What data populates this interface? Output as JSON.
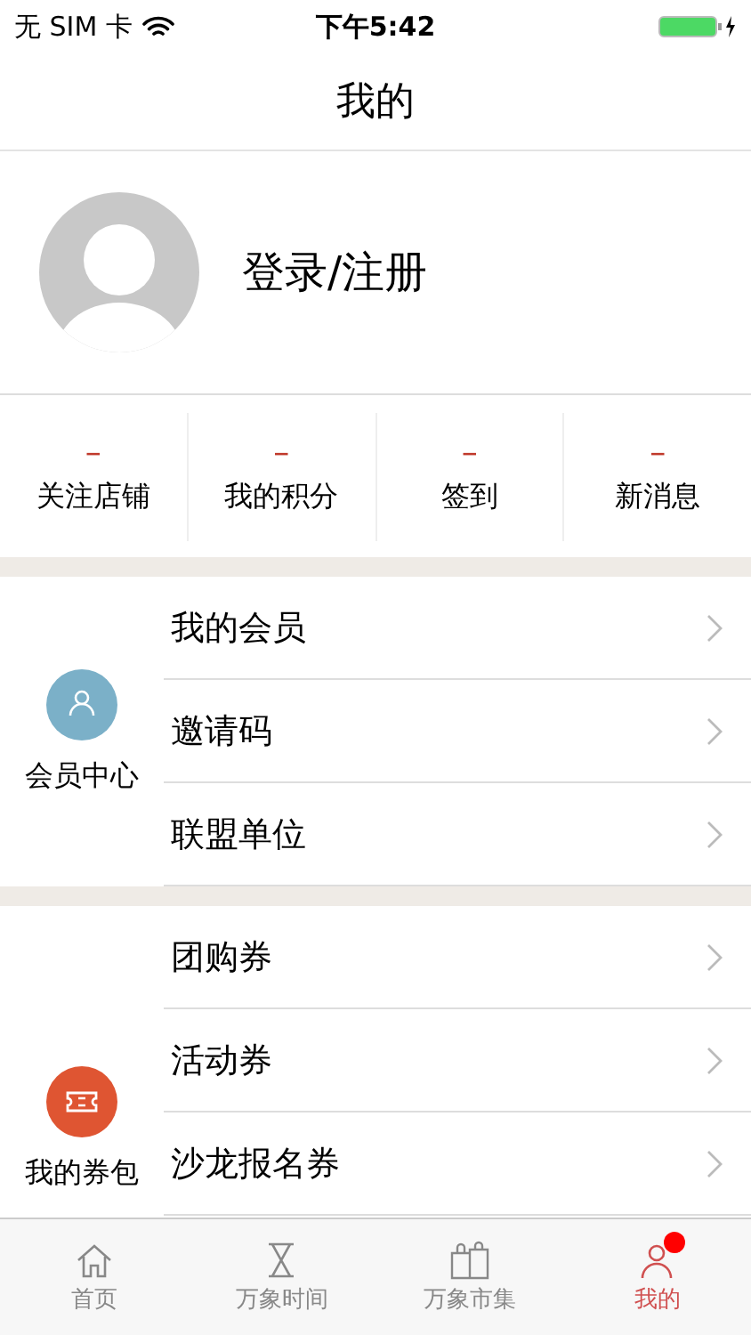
{
  "status_bar": {
    "carrier": "无 SIM 卡",
    "time": "下午5:42"
  },
  "nav": {
    "title": "我的"
  },
  "profile": {
    "login": "登录/注册"
  },
  "stats": [
    {
      "value": "–",
      "label": "关注店铺"
    },
    {
      "value": "–",
      "label": "我的积分"
    },
    {
      "value": "–",
      "label": "签到"
    },
    {
      "value": "–",
      "label": "新消息"
    }
  ],
  "sections": [
    {
      "title": "会员中心",
      "kind": "person",
      "items": [
        "我的会员",
        "邀请码",
        "联盟单位"
      ]
    },
    {
      "title": "我的券包",
      "kind": "ticket",
      "items": [
        "团购券",
        "活动券",
        "沙龙报名券"
      ]
    }
  ],
  "tabs": [
    {
      "label": "首页",
      "kind": "home",
      "selected": false,
      "badge": false
    },
    {
      "label": "万象时间",
      "kind": "hourglass",
      "selected": false,
      "badge": false
    },
    {
      "label": "万象市集",
      "kind": "bags",
      "selected": false,
      "badge": false
    },
    {
      "label": "我的",
      "kind": "person",
      "selected": true,
      "badge": true
    }
  ]
}
